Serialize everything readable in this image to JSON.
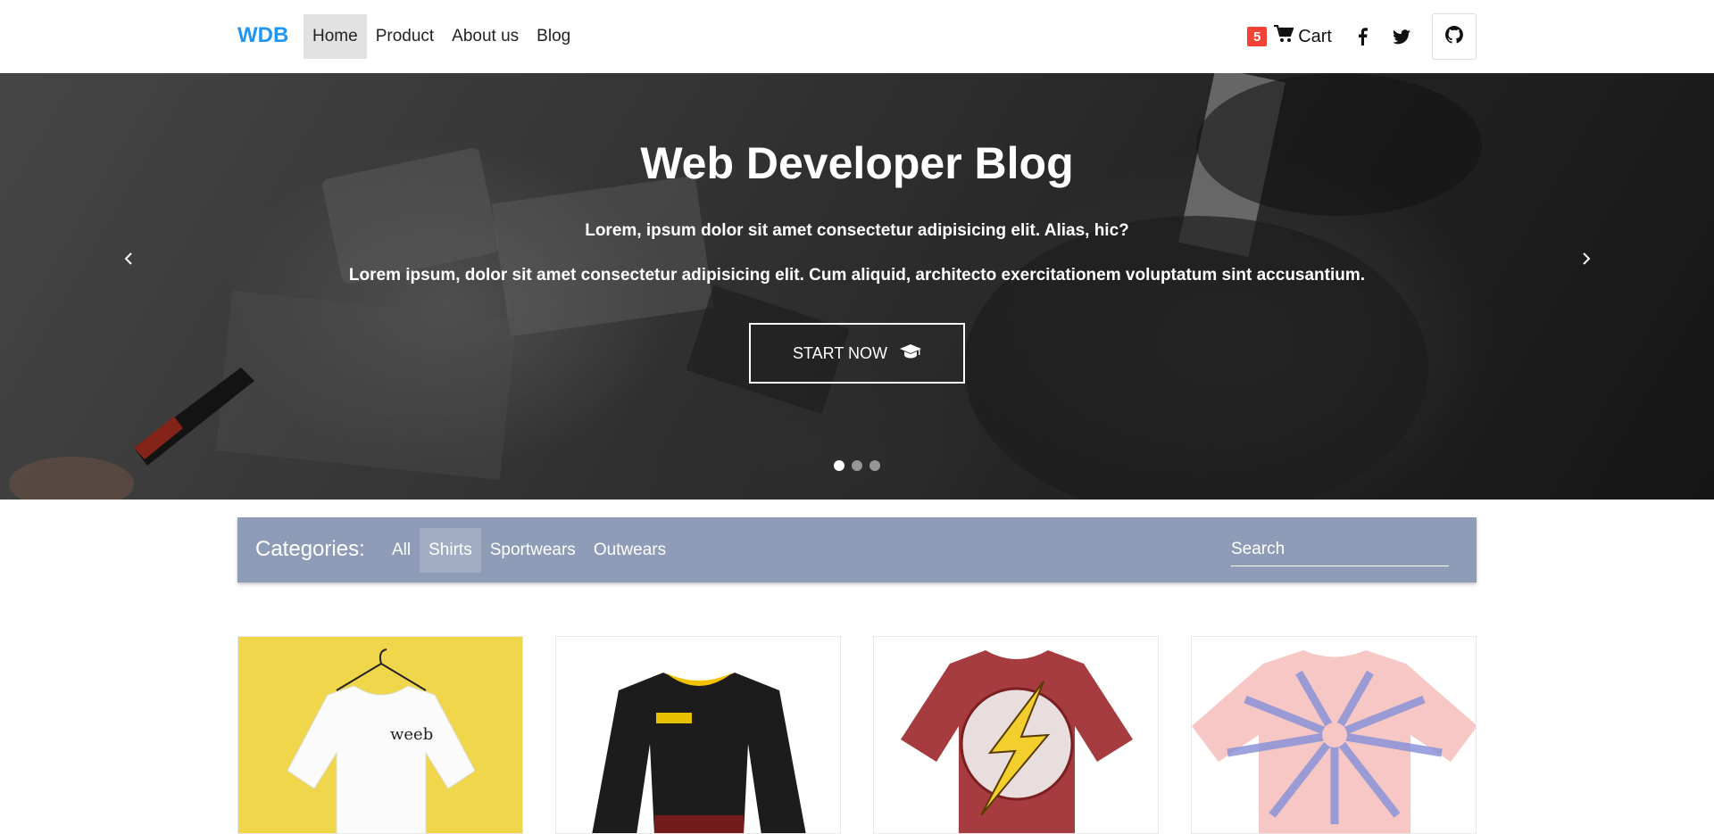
{
  "navbar": {
    "brand": "WDB",
    "links": [
      {
        "label": "Home",
        "active": true
      },
      {
        "label": "Product",
        "active": false
      },
      {
        "label": "About us",
        "active": false
      },
      {
        "label": "Blog",
        "active": false
      }
    ],
    "cart_count": "5",
    "cart_label": "Cart",
    "icons": [
      "cart-icon",
      "facebook-icon",
      "twitter-icon",
      "github-icon"
    ]
  },
  "hero": {
    "title": "Web Developer Blog",
    "line1": "Lorem, ipsum dolor sit amet consectetur adipisicing elit. Alias, hic?",
    "line2": "Lorem ipsum, dolor sit amet consectetur adipisicing elit. Cum aliquid, architecto exercitationem voluptatum sint accusantium.",
    "button_label": "START NOW",
    "slides": 3,
    "active_slide": 1
  },
  "categories": {
    "label": "Categories:",
    "items": [
      {
        "label": "All",
        "active": false
      },
      {
        "label": "Shirts",
        "active": true
      },
      {
        "label": "Sportwears",
        "active": false
      },
      {
        "label": "Outwears",
        "active": false
      }
    ],
    "search_placeholder": "Search"
  },
  "products": [
    {
      "name": "white-tshirt-weeb",
      "shirt_text": "weeb"
    },
    {
      "name": "black-long-sleeve-jersey"
    },
    {
      "name": "red-flash-tshirt"
    },
    {
      "name": "tie-dye-tshirt"
    }
  ],
  "colors": {
    "brand": "#2196f3",
    "badge": "#f44336",
    "category_bar": "#8e9cb7"
  }
}
